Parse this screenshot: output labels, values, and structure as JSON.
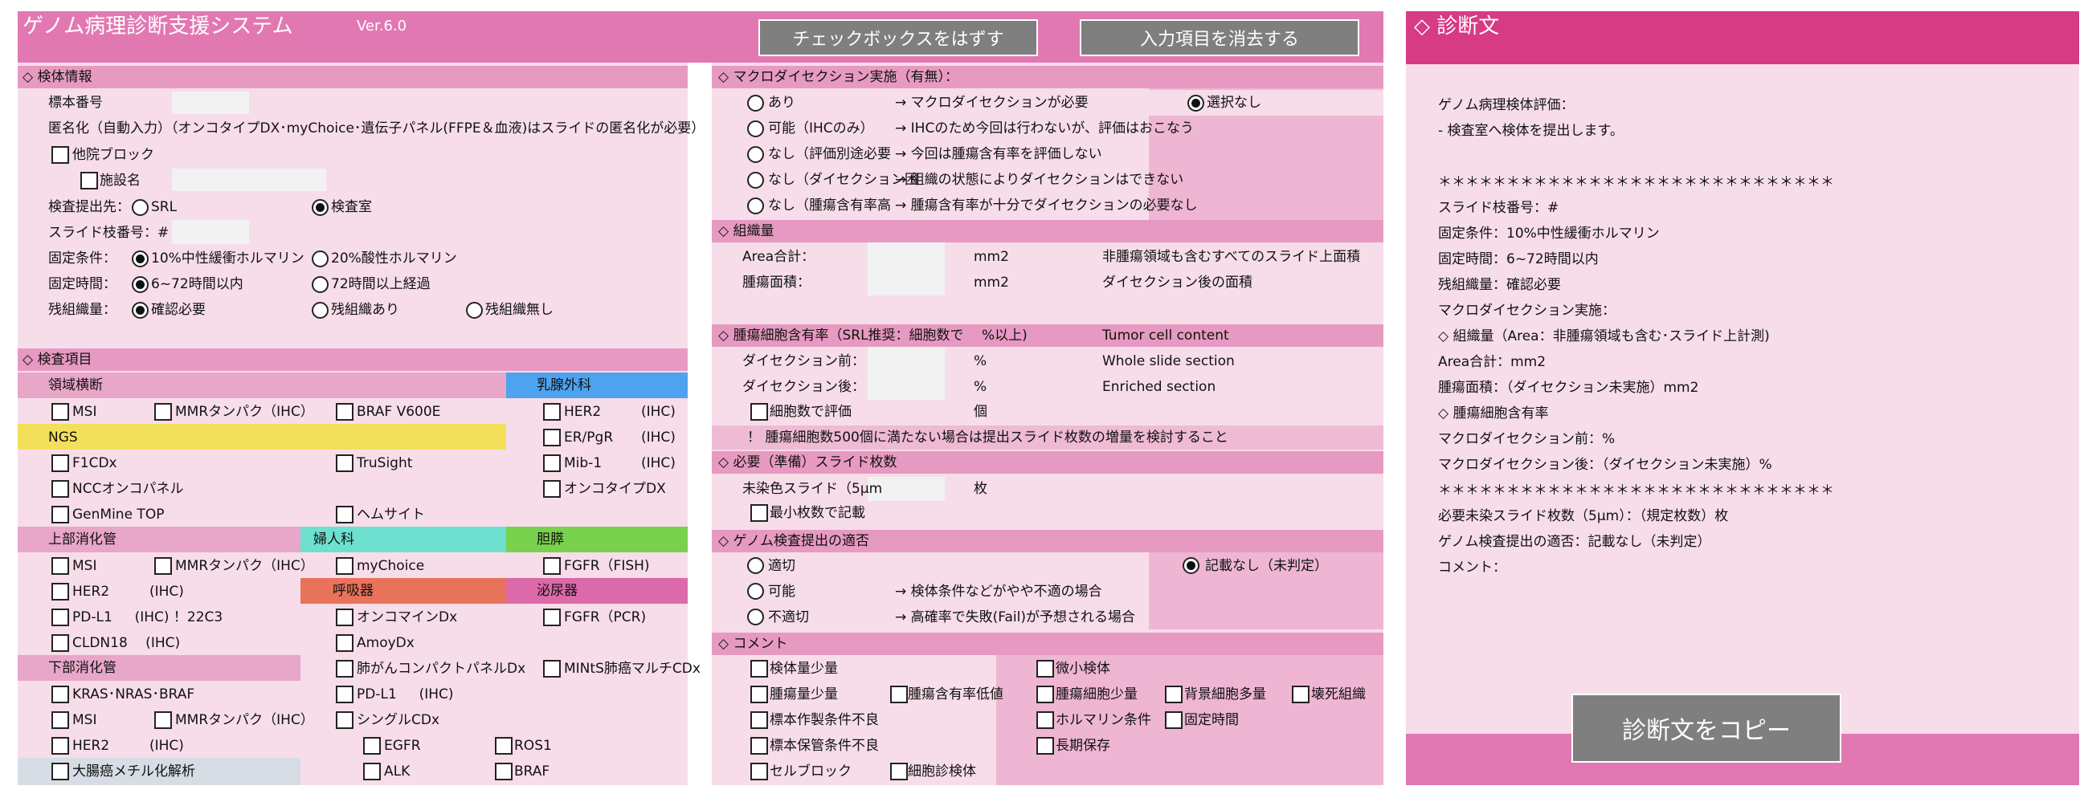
{
  "app": {
    "title": "ゲノム病理診断支援システム",
    "version": "Ver.6.0",
    "uncheck_button": "チェックボックスをはずす",
    "clear_button": "入力項目を消去する"
  },
  "specimen": {
    "header": "◇ 検体情報",
    "number_label": "標本番号",
    "anon_label": "匿名化（自動入力）（オンコタイプDX･myChoice･遺伝子パネル(FFPE＆血液)はスライドの匿名化が必要）",
    "other_block": "他院ブロック",
    "facility": "施設名",
    "dest_label": "検査提出先：",
    "dest_srl": "SRL",
    "dest_lab": "検査室",
    "slide_label": "スライド枝番号：#",
    "fix_label": "固定条件：",
    "fix_opt1": "10%中性緩衝ホルマリン",
    "fix_opt2": "20%酸性ホルマリン",
    "time_label": "固定時間：",
    "time_opt1": "6~72時間以内",
    "time_opt2": "72時間以上経過",
    "residual_label": "残組織量：",
    "residual_opt1": "確認必要",
    "residual_opt2": "残組織あり",
    "residual_opt3": "残組織無し"
  },
  "tests": {
    "header": "◇ 検査項目",
    "cross": "領域横断",
    "breast": "乳腺外科",
    "msi": "MSI",
    "mmr": "MMRタンパク（IHC）",
    "braf": "BRAF V600E",
    "her2": "HER2",
    "ihc": "(IHC)",
    "er_pgr": "ER/PgR",
    "ngs": "NGS",
    "f1cdx": "F1CDx",
    "trusight": "TruSight",
    "mib1": "Mib-1",
    "ncc": "NCCオンコパネル",
    "oncotype": "オンコタイプDX",
    "genmine": "GenMine TOP",
    "hemesite": "ヘムサイト",
    "upper_gi": "上部消化管",
    "gyn": "婦人科",
    "pancreas": "胆膵",
    "mychoice": "myChoice",
    "fgfr_fish": "FGFR（FISH)",
    "respiratory": "呼吸器",
    "urology": "泌尿器",
    "pdl1_22c3": "PD-L1 　 (IHC) ！22C3",
    "oncomine": "オンコマインDx",
    "fgfr_pcr": "FGFR（PCR)",
    "cldn18": "CLDN18 　(IHC)",
    "amoydx": "AmoyDx",
    "lower_gi": "下部消化管",
    "lung_panel": "肺がんコンパクトパネルDx",
    "mints": "MINtS肺癌マルチCDx",
    "kras": "KRAS･NRAS･BRAF",
    "pdl1_ihc": "PD-L1 　 (IHC)",
    "single_cdx": "シングルCDx",
    "egfr": "EGFR",
    "ros1": "ROS1",
    "crc_methyl": "大腸癌メチル化解析",
    "alk": "ALK",
    "braf2": "BRAF"
  },
  "macro": {
    "header": "◇ マクロダイセクション実施（有無）：",
    "opt1": "あり",
    "opt1_desc": "→ マクロダイセクションが必要",
    "opt2": "可能（IHCのみ）",
    "opt2_desc": "→ IHCのため今回は行わないが、評価はおこなう",
    "opt3": "なし（評価別途必要",
    "opt3_desc": "→ 今回は腫瘍含有率を評価しない",
    "opt4": "なし（ダイセクション困",
    "opt4_desc": "→ 組織の状態によりダイセクションはできない",
    "opt5": "なし（腫瘍含有率高",
    "opt5_desc": "→ 腫瘍含有率が十分でダイセクションの必要なし",
    "none": "選択なし"
  },
  "tissue": {
    "header": "◇ 組織量",
    "area_label": "Area合計：",
    "tumor_area_label": "腫瘍面積：",
    "unit": "mm2",
    "area_desc": "非腫瘍領域も含むすべてのスライド上面積",
    "tumor_desc": "ダイセクション後の面積"
  },
  "tumor_cell": {
    "header": "◇ 腫瘍細胞含有率（SRL推奨：細胞数で 　%以上)",
    "header_en": "Tumor cell content",
    "before": "ダイセクション前：",
    "after": "ダイセクション後：",
    "pct": "%",
    "whole": "Whole slide section",
    "enriched": "Enriched section",
    "count_eval": "細胞数で評価",
    "count_unit": "個",
    "warning": "！ 腫瘍細胞数500個に満たない場合は提出スライド枚数の増量を検討すること"
  },
  "slides": {
    "header": "◇ 必要（準備）スライド枚数",
    "unstained": "未染色スライド（5μm",
    "unit": "枚",
    "min": "最小枚数で記載"
  },
  "suitability": {
    "header": "◇ ゲノム検査提出の適否",
    "ok": "適切",
    "possible": "可能",
    "possible_desc": "→ 検体条件などがやや不適の場合",
    "bad": "不適切",
    "bad_desc": "→ 高確率で失敗(Fail)が予想される場合",
    "none": "記載なし（未判定）"
  },
  "comment": {
    "header": "◇ コメント",
    "c1": "検体量少量",
    "c2": "微小検体",
    "c3": "腫瘍量少量",
    "c4": "腫瘍含有率低値",
    "c5": "腫瘍細胞少量",
    "c6": "背景細胞多量",
    "c7": "壊死組織",
    "c8": "標本作製条件不良",
    "c9": "ホルマリン条件",
    "c10": "固定時間",
    "c11": "標本保管条件不良",
    "c12": "長期保存",
    "c13": "セルブロック",
    "c14": "細胞診検体"
  },
  "report": {
    "header": "◇ 診断文",
    "lines": [
      "ゲノム病理検体評価：",
      "- 検査室へ検体を提出します。",
      "",
      "＊＊＊＊＊＊＊＊＊＊＊＊＊＊＊＊＊＊＊＊＊＊＊＊＊＊＊＊＊",
      "スライド枝番号：#",
      "固定条件：10%中性緩衝ホルマリン",
      "固定時間：6~72時間以内",
      "残組織量：確認必要",
      "マクロダイセクション実施：",
      "◇ 組織量（Area：非腫瘍領域も含む･スライド上計測)",
      "Area合計：mm2",
      "腫瘍面積：（ダイセクション未実施）mm2",
      "◇ 腫瘍細胞含有率",
      "マクロダイセクション前：%",
      "マクロダイセクション後：（ダイセクション未実施）%",
      "＊＊＊＊＊＊＊＊＊＊＊＊＊＊＊＊＊＊＊＊＊＊＊＊＊＊＊＊＊",
      "必要未染スライド枚数（5μm）：（規定枚数）枚",
      "ゲノム検査提出の適否：記載なし（未判定）",
      "コメント："
    ],
    "copy_button": "診断文をコピー"
  },
  "colors": {
    "title_bar": "#e278b2",
    "panel": "#f7dde9",
    "section": "#e79ac1",
    "report_header": "#d63b84",
    "breast": "#4da3f0",
    "ngs": "#f3e05a",
    "gyn": "#6ee0cf",
    "pancreas": "#79d14e",
    "respiratory": "#e9735a",
    "urology": "#dc69a9",
    "methyl": "#d6dde4"
  }
}
